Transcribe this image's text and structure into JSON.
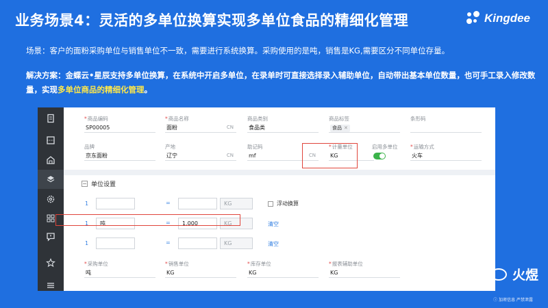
{
  "slide": {
    "title": "业务场景4：灵活的多单位换算实现多单位食品的精细化管理",
    "logo_text": "Kingdee",
    "scenario": "场景：客户的面粉采购单位与销售单位不一致，需要进行系统换算。采购使用的是吨，销售是KG,需要区分不同单位存量。",
    "solution_plain": "解决方案：金蝶云•星辰支持多单位换算，在系统中开启多单位，在录单时可直接选择录入辅助单位，自动带出基本单位数量，也可手工录入修改数量，实现",
    "solution_highlight": "多单位商品的精细化管理",
    "solution_end": "。",
    "brand": "火煜",
    "footnote": "ⓘ 加密信息 严禁泄露",
    "accent": "#1f6fe0",
    "highlight_color": "#ffe84a"
  },
  "sidebar": {
    "icons": [
      "document-icon",
      "ticket-icon",
      "warehouse-icon",
      "layers-icon",
      "settings-icon",
      "apps-icon",
      "message-icon",
      "star-icon",
      "menu-icon"
    ],
    "active": "layers-icon"
  },
  "form": {
    "row1": [
      {
        "label": "商品编码",
        "required": true,
        "value": "SP00005",
        "suffix": ""
      },
      {
        "label": "商品名称",
        "required": true,
        "value": "面粉",
        "suffix": "CN"
      },
      {
        "label": "商品类别",
        "required": false,
        "value": "食品类",
        "suffix": ""
      },
      {
        "label": "商品标签",
        "required": false,
        "tag": "食品",
        "value": "",
        "suffix": ""
      },
      {
        "label": "条形码",
        "required": false,
        "value": "",
        "suffix": ""
      }
    ],
    "row2": [
      {
        "label": "品牌",
        "required": false,
        "value": "京东面粉",
        "suffix": ""
      },
      {
        "label": "产地",
        "required": false,
        "value": "辽宁",
        "suffix": "CN"
      },
      {
        "label": "助记码",
        "required": false,
        "value": "mf",
        "suffix": "CN"
      },
      {
        "label": "计量单位",
        "required": true,
        "value": "KG",
        "suffix": ""
      },
      {
        "label": "启用多单位",
        "required": false,
        "toggle": true
      },
      {
        "label": "运输方式",
        "required": true,
        "value": "火车",
        "suffix": ""
      }
    ],
    "bottom": [
      {
        "label": "采购单位",
        "required": true,
        "value": "吨"
      },
      {
        "label": "销售单位",
        "required": true,
        "value": "KG"
      },
      {
        "label": "库存单位",
        "required": true,
        "value": "KG"
      },
      {
        "label": "报表辅助单位",
        "required": true,
        "value": "KG"
      }
    ]
  },
  "units": {
    "section_title": "单位设置",
    "floating_label": "浮动换算",
    "rows": [
      {
        "num": "1",
        "unit": "",
        "eq": "=",
        "qty": "",
        "base": "KG",
        "action": ""
      },
      {
        "num": "1",
        "unit": "吨",
        "eq": "=",
        "qty": "1,000",
        "base": "KG",
        "action": "清空"
      },
      {
        "num": "1",
        "unit": "",
        "eq": "=",
        "qty": "",
        "base": "KG",
        "action": "清空"
      }
    ]
  }
}
